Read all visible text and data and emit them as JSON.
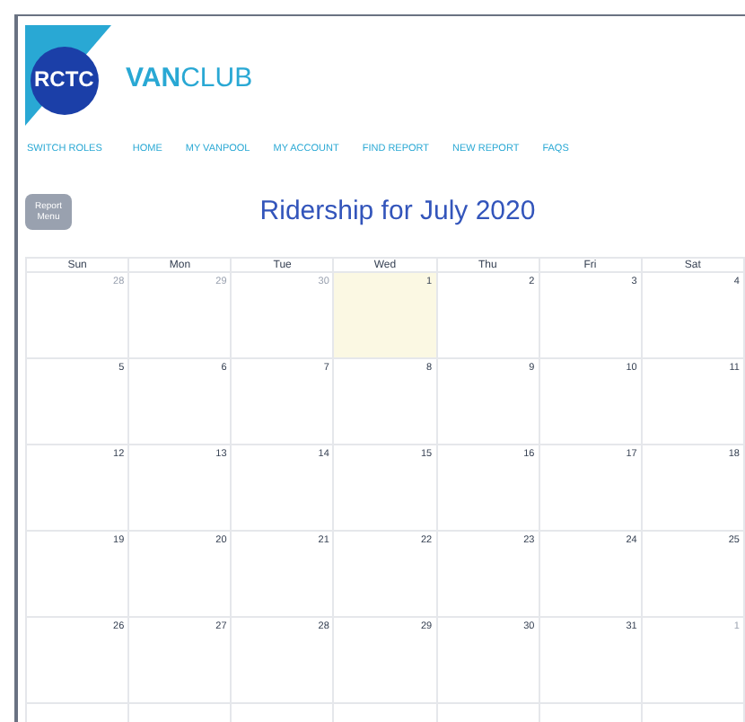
{
  "logo": {
    "badge": "RCTC",
    "brand_bold": "VAN",
    "brand_rest": "CLUB"
  },
  "nav": [
    "SWITCH ROLES",
    "HOME",
    "MY VANPOOL",
    "MY ACCOUNT",
    "FIND REPORT",
    "NEW REPORT",
    "FAQS"
  ],
  "report_menu_button": "Report Menu",
  "title": "Ridership for July 2020",
  "calendar": {
    "weekdays": [
      "Sun",
      "Mon",
      "Tue",
      "Wed",
      "Thu",
      "Fri",
      "Sat"
    ],
    "weeks": [
      [
        {
          "day": "28",
          "outside": true,
          "today": false
        },
        {
          "day": "29",
          "outside": true,
          "today": false
        },
        {
          "day": "30",
          "outside": true,
          "today": false
        },
        {
          "day": "1",
          "outside": false,
          "today": true
        },
        {
          "day": "2",
          "outside": false,
          "today": false
        },
        {
          "day": "3",
          "outside": false,
          "today": false
        },
        {
          "day": "4",
          "outside": false,
          "today": false
        }
      ],
      [
        {
          "day": "5",
          "outside": false,
          "today": false
        },
        {
          "day": "6",
          "outside": false,
          "today": false
        },
        {
          "day": "7",
          "outside": false,
          "today": false
        },
        {
          "day": "8",
          "outside": false,
          "today": false
        },
        {
          "day": "9",
          "outside": false,
          "today": false
        },
        {
          "day": "10",
          "outside": false,
          "today": false
        },
        {
          "day": "11",
          "outside": false,
          "today": false
        }
      ],
      [
        {
          "day": "12",
          "outside": false,
          "today": false
        },
        {
          "day": "13",
          "outside": false,
          "today": false
        },
        {
          "day": "14",
          "outside": false,
          "today": false
        },
        {
          "day": "15",
          "outside": false,
          "today": false
        },
        {
          "day": "16",
          "outside": false,
          "today": false
        },
        {
          "day": "17",
          "outside": false,
          "today": false
        },
        {
          "day": "18",
          "outside": false,
          "today": false
        }
      ],
      [
        {
          "day": "19",
          "outside": false,
          "today": false
        },
        {
          "day": "20",
          "outside": false,
          "today": false
        },
        {
          "day": "21",
          "outside": false,
          "today": false
        },
        {
          "day": "22",
          "outside": false,
          "today": false
        },
        {
          "day": "23",
          "outside": false,
          "today": false
        },
        {
          "day": "24",
          "outside": false,
          "today": false
        },
        {
          "day": "25",
          "outside": false,
          "today": false
        }
      ],
      [
        {
          "day": "26",
          "outside": false,
          "today": false
        },
        {
          "day": "27",
          "outside": false,
          "today": false
        },
        {
          "day": "28",
          "outside": false,
          "today": false
        },
        {
          "day": "29",
          "outside": false,
          "today": false
        },
        {
          "day": "30",
          "outside": false,
          "today": false
        },
        {
          "day": "31",
          "outside": false,
          "today": false
        },
        {
          "day": "1",
          "outside": true,
          "today": false
        }
      ]
    ]
  }
}
